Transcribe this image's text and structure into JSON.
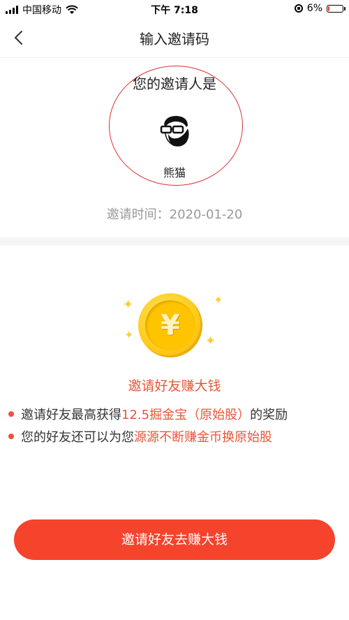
{
  "status_bar": {
    "carrier": "中国移动",
    "time": "下午 7:18",
    "battery": "6%",
    "battery_level": 0.06
  },
  "nav": {
    "back_icon": "chevron-left-icon",
    "title": "输入邀请码"
  },
  "inviter": {
    "title": "您的邀请人是",
    "avatar_icon": "bearded-man-glasses-avatar",
    "name": "熊猫",
    "time_label": "邀请时间：",
    "time_value": "2020-01-20"
  },
  "promo": {
    "coin_symbol": "¥",
    "title": "邀请好友赚大钱",
    "benefits": [
      {
        "prefix": "邀请好友最高获得",
        "highlight": "12.5掘金宝（原始股）",
        "suffix": "的奖励"
      },
      {
        "prefix": "您的好友还可以为您",
        "highlight": "源源不断赚金币换原始股",
        "suffix": ""
      }
    ]
  },
  "cta": {
    "label": "邀请好友去赚大钱"
  },
  "colors": {
    "accent": "#f5432c",
    "highlight": "#e8553a",
    "circle": "#d93030"
  }
}
